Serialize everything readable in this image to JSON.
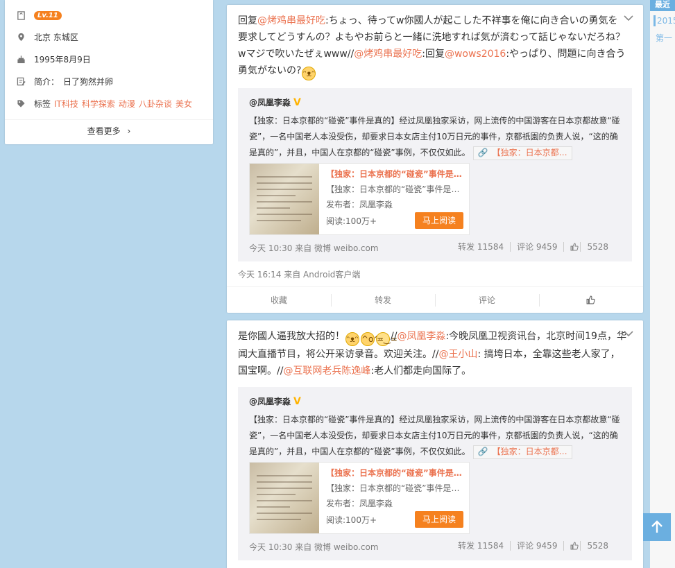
{
  "profile": {
    "level": "Lv.11",
    "location": "北京 东城区",
    "birthday": "1995年8月9日",
    "bio_label": "简介：",
    "bio": "日了狗然并卵",
    "tags_label": "标签",
    "tags": [
      "IT科技",
      "科学探索",
      "动漫",
      "八卦杂谈",
      "美女"
    ],
    "more_label": "查看更多"
  },
  "right": {
    "latest": "最近",
    "year": "2015",
    "first": "第一"
  },
  "repost": {
    "author": "@凤凰李淼",
    "text": "【独家：日本京都的“碰瓷”事件是真的】经过凤凰独家采访，网上流传的中国游客在日本京都故意“碰瓷”，一名中国老人本没受伤，却要求日本女店主付10万日元的事件，京都祇園的负责人说，“这的确是真的”，并且，中国人在京都的“碰瓷”事例，不仅仅如此。",
    "link_chip": "【独家：日本京都…",
    "article_title": "【独家：日本京都的“碰瓷”事件是…",
    "article_desc": "【独家：日本京都的“碰瓷”事件是真…",
    "publisher": "发布者：凤凰李淼",
    "reads": "阅读:100万+",
    "read_btn": "马上阅读",
    "source": "今天 10:30 来自 微博 weibo.com",
    "reposts": "转发 11584",
    "comments": "评论 9459",
    "likes": "5528"
  },
  "posts": [
    {
      "seg": [
        {
          "t": "回复"
        },
        {
          "t": "@烤鸡串最好吃",
          "link": true
        },
        {
          "t": ":ちょっ、待ってw你國人が起こした不祥事を俺に向き合いの勇気を要求してどうすんの？よもやお前らと一緒に洗地すれば気が済むって話じゃないだろね？wマジで吹いたぜぇwww//"
        },
        {
          "t": "@烤鸡串最好吃",
          "link": true
        },
        {
          "t": ":回复"
        },
        {
          "t": "@wows2016",
          "link": true
        },
        {
          "t": ":やっぱり、問題に向き合う勇気がないの?"
        }
      ],
      "time": "今天 16:14 来自 Android客户端",
      "actions": [
        "收藏",
        "转发",
        "评论"
      ]
    },
    {
      "seg": [
        {
          "t": "是你國人逼我放大招的！"
        },
        {
          "t": "//"
        },
        {
          "t": "@凤凰李淼",
          "link": true
        },
        {
          "t": ":今晚凤凰卫视资讯台，北京时间19点，华闻大直播节目，将公开采访录音。欢迎关注。//"
        },
        {
          "t": "@王小山",
          "link": true
        },
        {
          "t": ": 搞垮日本，全靠这些老人家了，国宝啊。//"
        },
        {
          "t": "@互联网老兵陈逸峰",
          "link": true
        },
        {
          "t": ":老人们都走向国际了。"
        }
      ]
    }
  ]
}
